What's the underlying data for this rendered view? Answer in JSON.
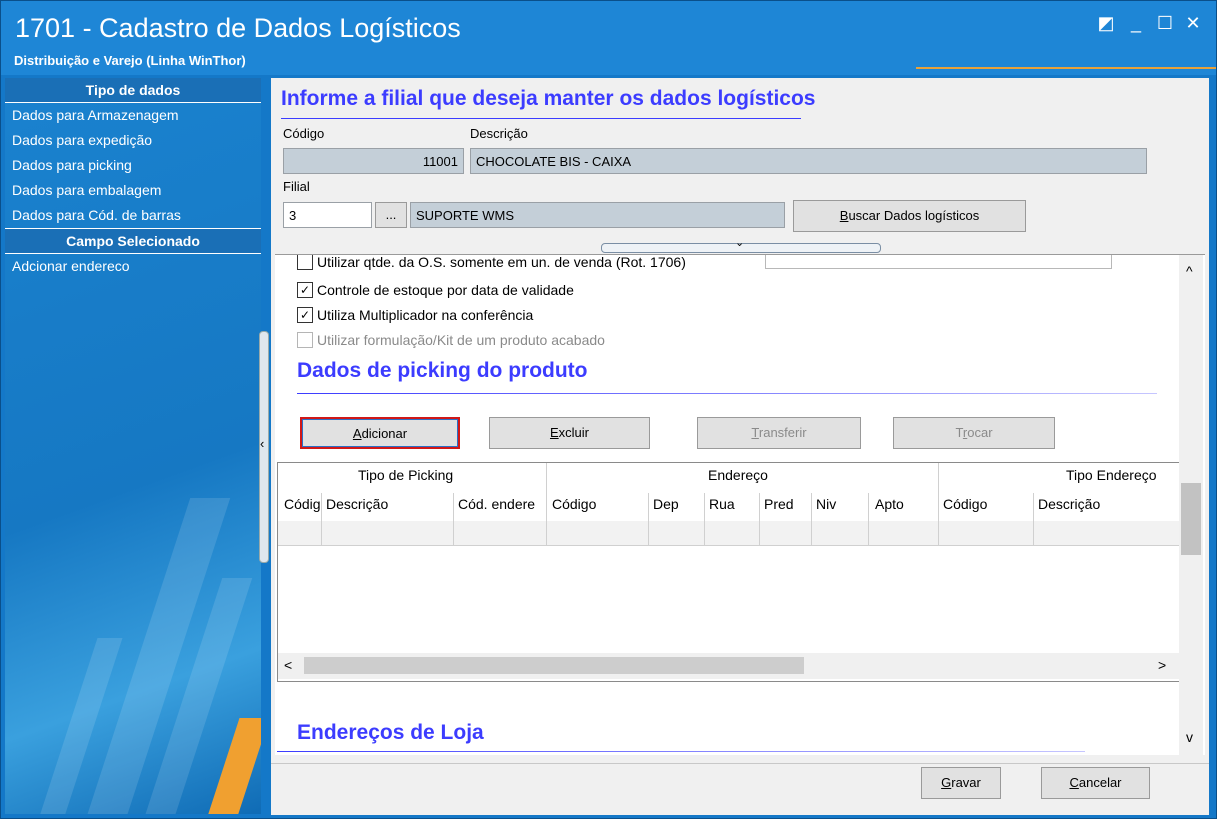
{
  "window": {
    "title": "1701 - Cadastro de Dados Logísticos",
    "subtitle": "Distribuição e Varejo (Linha WinThor)",
    "controls": [
      "◩",
      "_",
      "☐",
      "✕"
    ]
  },
  "sidebar": {
    "section1_title": "Tipo de dados",
    "items": [
      {
        "label": "Dados para Armazenagem"
      },
      {
        "label": "Dados para expedição"
      },
      {
        "label": "Dados para picking"
      },
      {
        "label": "Dados para embalagem"
      },
      {
        "label": "Dados para Cód. de barras"
      }
    ],
    "section2_title": "Campo Selecionado",
    "selected_field": "Adcionar endereco"
  },
  "form": {
    "heading": "Informe a filial que deseja manter os dados logísticos",
    "codigo_label": "Código",
    "codigo_value": "11001",
    "descricao_label": "Descrição",
    "descricao_value": "CHOCOLATE BIS  - CAIXA",
    "filial_label": "Filial",
    "filial_value": "3",
    "filial_lookup": "...",
    "filial_name": "SUPORTE WMS",
    "buscar_label": "Buscar Dados logísticos"
  },
  "options": [
    {
      "label": "Utilizar qtde. da O.S. somente em un. de venda (Rot. 1706)",
      "checked": false,
      "disabled": false
    },
    {
      "label": "Controle de estoque por data de validade",
      "checked": true,
      "disabled": false
    },
    {
      "label": "Utiliza Multiplicador na conferência",
      "checked": true,
      "disabled": false
    },
    {
      "label": "Utilizar formulação/Kit de um produto acabado",
      "checked": false,
      "disabled": true
    }
  ],
  "picking": {
    "heading": "Dados de picking do produto",
    "buttons": {
      "adicionar": "Adicionar",
      "excluir": "Excluir",
      "transferir": "Transferir",
      "trocar": "Trocar"
    },
    "groups": {
      "tipo_picking": "Tipo de Picking",
      "endereco": "Endereço",
      "tipo_endereco": "Tipo Endereço"
    },
    "columns": {
      "codigo1": "Códig",
      "descricao1": "Descrição",
      "cod_endereco": "Cód. endere",
      "codigo2": "Código",
      "dep": "Dep",
      "rua": "Rua",
      "pred": "Pred",
      "niv": "Niv",
      "apto": "Apto",
      "codigo3": "Código",
      "descricao3": "Descrição"
    },
    "scroll_left": "<",
    "scroll_right": ">"
  },
  "enderecos": {
    "heading": "Endereços de Loja"
  },
  "scroll_up": "^",
  "scroll_down": "v",
  "footer": {
    "gravar": "Gravar",
    "cancelar": "Cancelar"
  }
}
